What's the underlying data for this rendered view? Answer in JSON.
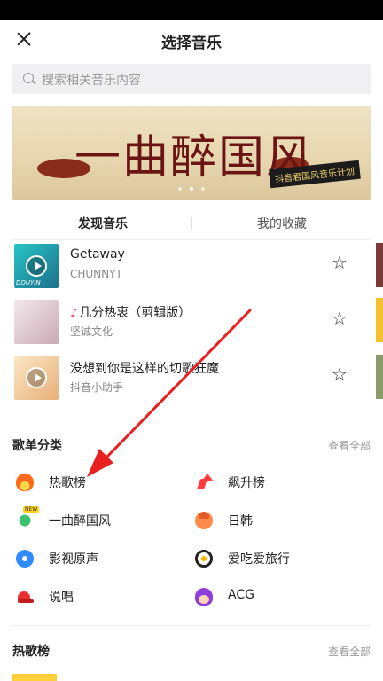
{
  "header": {
    "title": "选择音乐",
    "close_icon": "close-icon"
  },
  "search": {
    "placeholder": "搜索相关音乐内容",
    "icon": "search-icon"
  },
  "banner": {
    "title": "一曲醉国风",
    "subtitle": "抖音君国风音乐计划",
    "slide_count": 3,
    "active_slide": 2
  },
  "tabs": [
    {
      "label": "发现音乐",
      "active": true
    },
    {
      "label": "我的收藏",
      "active": false
    }
  ],
  "songs": [
    {
      "title": "Getaway",
      "artist": "CHUNNYT",
      "cover_tag": "DOUYIN",
      "has_note": false,
      "favorited": false
    },
    {
      "title": "几分热衷（剪辑版）",
      "artist": "坚诚文化",
      "has_note": true,
      "favorited": false
    },
    {
      "title": "没想到你是这样的切歌狂魔",
      "artist": "抖音小助手",
      "has_note": false,
      "favorited": false
    }
  ],
  "playlist_categories": {
    "title": "歌单分类",
    "more": "查看全部",
    "items": [
      {
        "label": "热歌榜",
        "icon": "fire-icon"
      },
      {
        "label": "飙升榜",
        "icon": "rising-icon"
      },
      {
        "label": "一曲醉国风",
        "icon": "clover-icon",
        "badge": "NEW"
      },
      {
        "label": "日韩",
        "icon": "face-icon"
      },
      {
        "label": "影视原声",
        "icon": "film-reel-icon"
      },
      {
        "label": "爱吃爱旅行",
        "icon": "bowl-icon"
      },
      {
        "label": "说唱",
        "icon": "cap-icon"
      },
      {
        "label": "ACG",
        "icon": "anime-icon"
      }
    ]
  },
  "hot_chart": {
    "title": "热歌榜",
    "more": "查看全部"
  },
  "annotation": {
    "arrow_color": "#e82020"
  },
  "colors": {
    "accent_red": "#ff3b5c",
    "muted": "#999999"
  }
}
